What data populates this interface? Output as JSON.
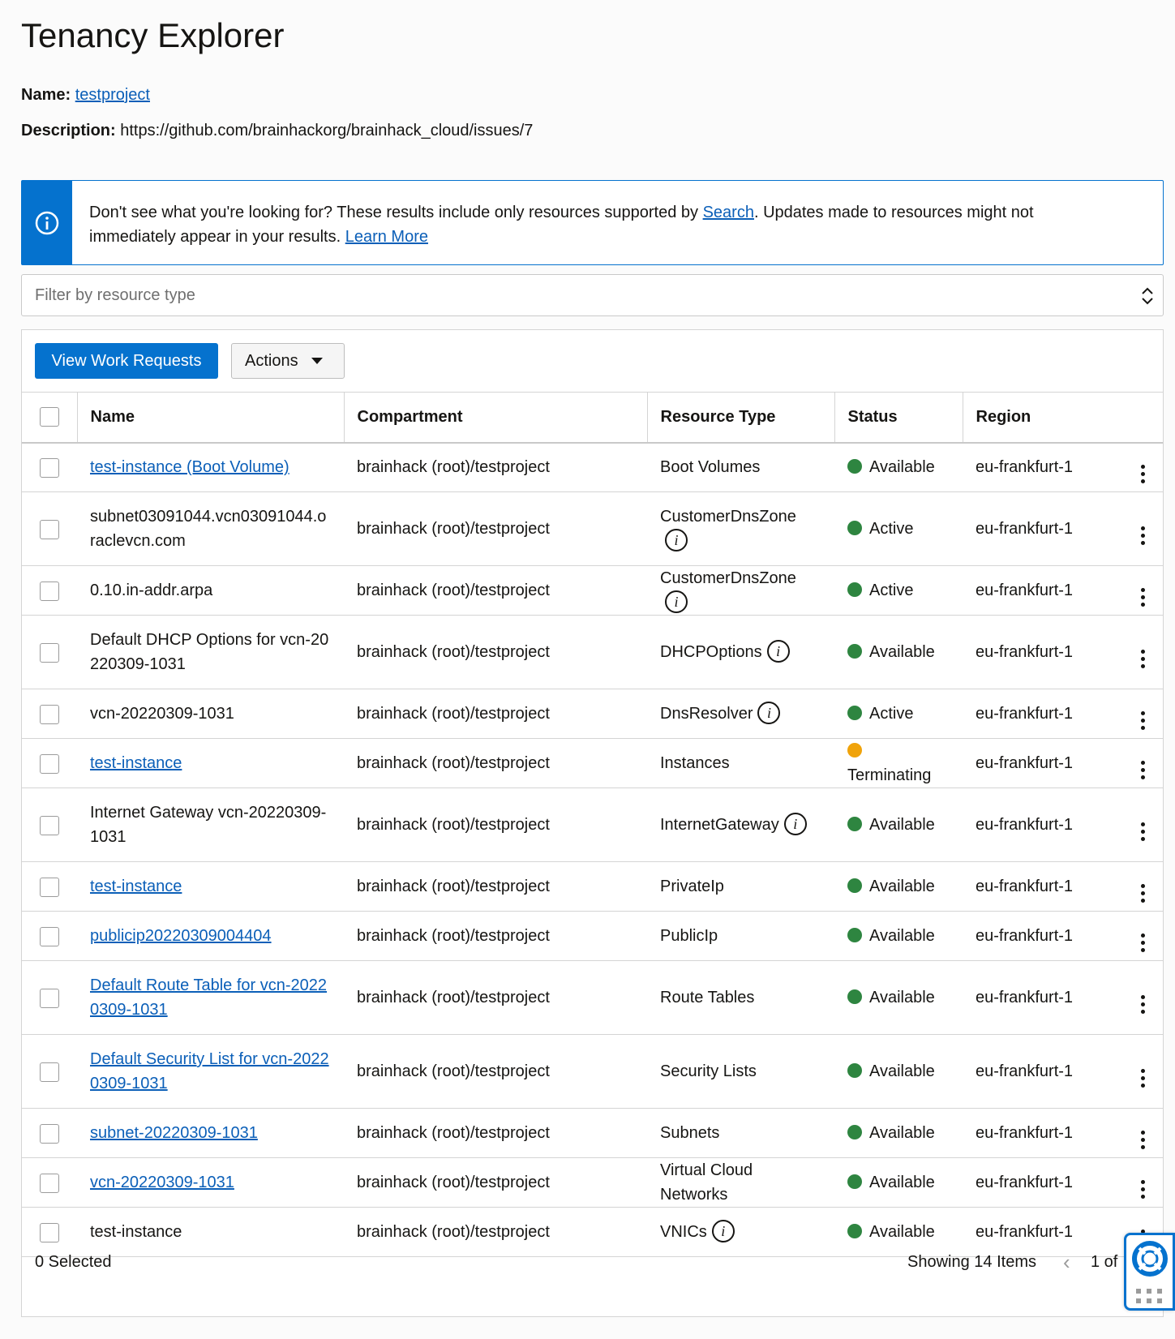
{
  "page": {
    "title": "Tenancy Explorer",
    "name_label": "Name:",
    "name_value": "testproject",
    "description_label": "Description:",
    "description_value": "https://github.com/brainhackorg/brainhack_cloud/issues/7"
  },
  "info_banner": {
    "text_before": "Don't see what you're looking for? These results include only resources supported by ",
    "search_link": "Search",
    "text_after": ". Updates made to resources might not immediately appear in your results. ",
    "learn_more_link": "Learn More"
  },
  "filter": {
    "placeholder": "Filter by resource type"
  },
  "toolbar": {
    "view_work_requests": "View Work Requests",
    "actions": "Actions"
  },
  "table": {
    "columns": [
      "Name",
      "Compartment",
      "Resource Type",
      "Status",
      "Region"
    ],
    "rows": [
      {
        "name": "test-instance (Boot Volume)",
        "name_link": true,
        "compartment": "brainhack (root)/testproject",
        "resource_type": "Boot Volumes",
        "type_info": false,
        "status": "Available",
        "region": "eu-frankfurt-1",
        "tall": false
      },
      {
        "name": "subnet03091044.vcn03091044.oraclevcn.com",
        "name_link": false,
        "compartment": "brainhack (root)/testproject",
        "resource_type": "CustomerDnsZone",
        "type_info": true,
        "status": "Active",
        "region": "eu-frankfurt-1",
        "tall": true
      },
      {
        "name": "0.10.in-addr.arpa",
        "name_link": false,
        "compartment": "brainhack (root)/testproject",
        "resource_type": "CustomerDnsZone",
        "type_info": true,
        "status": "Active",
        "region": "eu-frankfurt-1",
        "tall": false
      },
      {
        "name": "Default DHCP Options for vcn-20220309-1031",
        "name_link": false,
        "compartment": "brainhack (root)/testproject",
        "resource_type": "DHCPOptions",
        "type_info": true,
        "status": "Available",
        "region": "eu-frankfurt-1",
        "tall": true
      },
      {
        "name": "vcn-20220309-1031",
        "name_link": false,
        "compartment": "brainhack (root)/testproject",
        "resource_type": "DnsResolver",
        "type_info": true,
        "status": "Active",
        "region": "eu-frankfurt-1",
        "tall": false
      },
      {
        "name": "test-instance",
        "name_link": true,
        "compartment": "brainhack (root)/testproject",
        "resource_type": "Instances",
        "type_info": false,
        "status": "Terminating",
        "region": "eu-frankfurt-1",
        "tall": false
      },
      {
        "name": "Internet Gateway vcn-20220309-1031",
        "name_link": false,
        "compartment": "brainhack (root)/testproject",
        "resource_type": "InternetGateway",
        "type_info": true,
        "status": "Available",
        "region": "eu-frankfurt-1",
        "tall": true
      },
      {
        "name": "test-instance",
        "name_link": true,
        "compartment": "brainhack (root)/testproject",
        "resource_type": "PrivateIp",
        "type_info": false,
        "status": "Available",
        "region": "eu-frankfurt-1",
        "tall": false
      },
      {
        "name": "publicip20220309004404",
        "name_link": true,
        "compartment": "brainhack (root)/testproject",
        "resource_type": "PublicIp",
        "type_info": false,
        "status": "Available",
        "region": "eu-frankfurt-1",
        "tall": false
      },
      {
        "name": "Default Route Table for vcn-20220309-1031",
        "name_link": true,
        "compartment": "brainhack (root)/testproject",
        "resource_type": "Route Tables",
        "type_info": false,
        "status": "Available",
        "region": "eu-frankfurt-1",
        "tall": true
      },
      {
        "name": "Default Security List for vcn-20220309-1031",
        "name_link": true,
        "compartment": "brainhack (root)/testproject",
        "resource_type": "Security Lists",
        "type_info": false,
        "status": "Available",
        "region": "eu-frankfurt-1",
        "tall": true
      },
      {
        "name": "subnet-20220309-1031",
        "name_link": true,
        "compartment": "brainhack (root)/testproject",
        "resource_type": "Subnets",
        "type_info": false,
        "status": "Available",
        "region": "eu-frankfurt-1",
        "tall": false
      },
      {
        "name": "vcn-20220309-1031",
        "name_link": true,
        "compartment": "brainhack (root)/testproject",
        "resource_type": "Virtual Cloud Networks",
        "type_info": false,
        "status": "Available",
        "region": "eu-frankfurt-1",
        "tall": false
      },
      {
        "name": "test-instance",
        "name_link": false,
        "compartment": "brainhack (root)/testproject",
        "resource_type": "VNICs",
        "type_info": true,
        "status": "Available",
        "region": "eu-frankfurt-1",
        "tall": false
      }
    ]
  },
  "footer": {
    "selected": "0 Selected",
    "showing": "Showing 14 Items",
    "page": "1 of"
  },
  "colors": {
    "accent": "#0572ce",
    "link": "#0b5fb8",
    "status_green": "#2e8540",
    "status_amber": "#f0a30a"
  },
  "icons": {
    "info_banner": "info-circle-icon",
    "filter_arrows": "chevron-up-down-icon",
    "actions_caret": "caret-down-icon",
    "row_menu": "kebab-menu-icon",
    "help": "lifebuoy-icon"
  }
}
